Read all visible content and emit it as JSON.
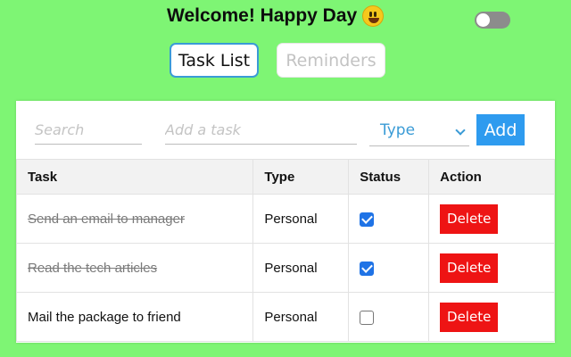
{
  "header": {
    "title": "Welcome! Happy Day",
    "emoji_icon": "grinning-face-icon",
    "theme_toggle": {
      "on": false
    }
  },
  "tabs": [
    {
      "label": "Task List",
      "active": true
    },
    {
      "label": "Reminders",
      "active": false
    }
  ],
  "inputs": {
    "search_placeholder": "Search",
    "task_placeholder": "Add a task",
    "type_select_value": "Type",
    "add_label": "Add"
  },
  "table": {
    "columns": [
      "Task",
      "Type",
      "Status",
      "Action"
    ],
    "rows": [
      {
        "task": "Send an email to manager",
        "type": "Personal",
        "done": true,
        "action": "Delete"
      },
      {
        "task": "Read the tech articles",
        "type": "Personal",
        "done": true,
        "action": "Delete"
      },
      {
        "task": "Mail the package to friend",
        "type": "Personal",
        "done": false,
        "action": "Delete"
      }
    ]
  },
  "colors": {
    "background": "#7ef574",
    "accent": "#2e9bef",
    "delete": "#ee1414",
    "checkbox": "#1f73e6"
  }
}
